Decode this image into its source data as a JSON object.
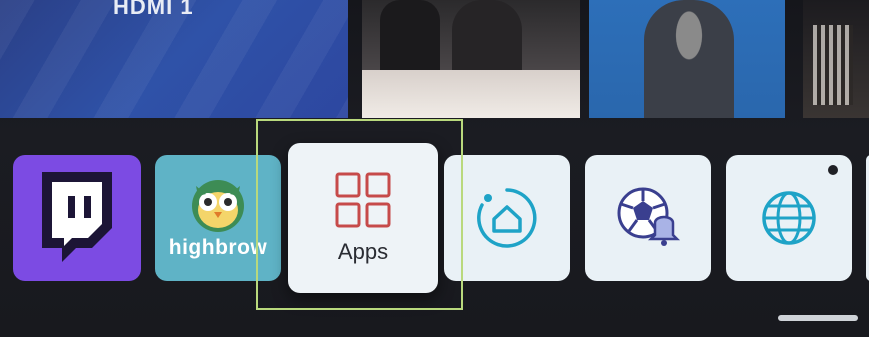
{
  "top_row": {
    "thumbnails": [
      {
        "title": "HDMI 1"
      },
      {
        "title": ""
      },
      {
        "title": ""
      },
      {
        "title": ""
      }
    ]
  },
  "apps_row": {
    "items": [
      {
        "label": "",
        "icon": "twitch-logo"
      },
      {
        "label": "highbrow",
        "icon": "highbrow-owl-logo"
      },
      {
        "label": "Apps",
        "icon": "apps-grid-icon",
        "focused": true
      },
      {
        "label": "",
        "icon": "home-dashboard-icon"
      },
      {
        "label": "",
        "icon": "sports-alert-icon"
      },
      {
        "label": "",
        "icon": "web-browser-globe-icon",
        "has_dot": true
      }
    ]
  },
  "colors": {
    "focus_outline": "#b9d97d",
    "twitch_purple": "#7c4be3",
    "highbrow_teal": "#5fb3c6",
    "apps_red": "#c64a4a",
    "cyan_accent": "#1ea3c7"
  }
}
